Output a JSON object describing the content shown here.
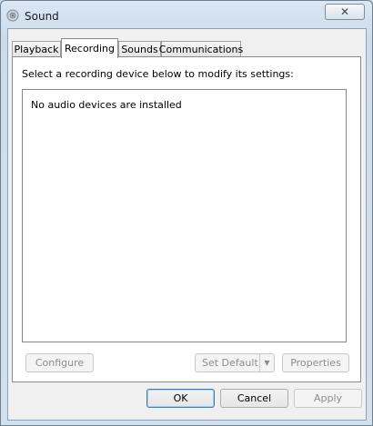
{
  "window": {
    "title": "Sound",
    "close_symbol": "✕"
  },
  "tabs": [
    {
      "label": "Playback"
    },
    {
      "label": "Recording"
    },
    {
      "label": "Sounds"
    },
    {
      "label": "Communications"
    }
  ],
  "active_tab": "Recording",
  "panel": {
    "instruction": "Select a recording device below to modify its settings:",
    "empty_message": "No audio devices are installed"
  },
  "panel_buttons": {
    "configure": "Configure",
    "set_default": "Set Default",
    "set_default_arrow": "▼",
    "properties": "Properties"
  },
  "dialog_buttons": {
    "ok": "OK",
    "cancel": "Cancel",
    "apply": "Apply"
  },
  "icons": {
    "app": "speaker-icon",
    "close": "close-icon",
    "dropdown": "chevron-down-icon"
  }
}
